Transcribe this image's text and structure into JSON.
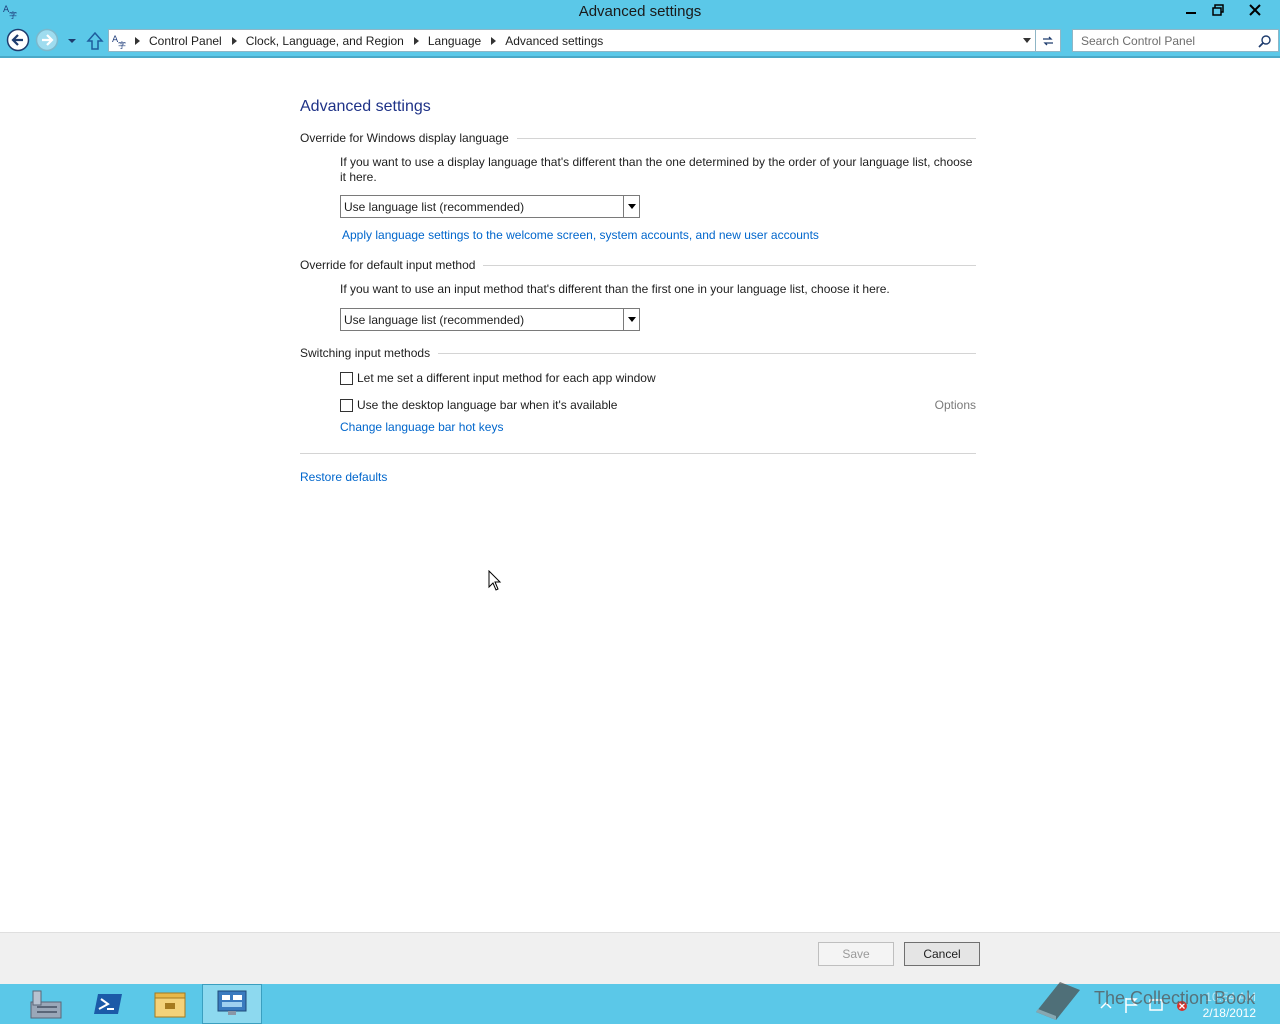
{
  "window": {
    "title": "Advanced settings",
    "app_icon": "language-globe-icon"
  },
  "navbar": {
    "breadcrumbs": [
      "Control Panel",
      "Clock, Language, and Region",
      "Language",
      "Advanced settings"
    ],
    "search_placeholder": "Search Control Panel"
  },
  "main": {
    "page_title": "Advanced settings",
    "display_language": {
      "heading": "Override for Windows display language",
      "description": "If you want to use a display language that's different than the one determined by the order of your language list, choose it here.",
      "selected": "Use language list (recommended)",
      "link": "Apply language settings to the welcome screen, system accounts, and new user accounts"
    },
    "input_method": {
      "heading": "Override for default input method",
      "description": "If you want to use an input method that's different than the first one in your language list, choose it here.",
      "selected": "Use language list (recommended)"
    },
    "switching": {
      "heading": "Switching input methods",
      "checkbox_app_window": "Let me set a different input method for each app window",
      "checkbox_language_bar": "Use the desktop language bar when it's available",
      "options_link": "Options",
      "hotkeys_link": "Change language bar hot keys"
    },
    "restore_link": "Restore defaults"
  },
  "footer": {
    "save_label": "Save",
    "cancel_label": "Cancel"
  },
  "taskbar": {
    "items": [
      "server-manager-icon",
      "powershell-icon",
      "file-explorer-icon",
      "control-panel-icon"
    ],
    "date": "2/18/2012",
    "time": "10:54 AM"
  },
  "watermark": {
    "text": "The Collection Book"
  },
  "colors": {
    "chrome": "#5bc8e8",
    "link": "#0066cc",
    "title": "#1e3287"
  }
}
